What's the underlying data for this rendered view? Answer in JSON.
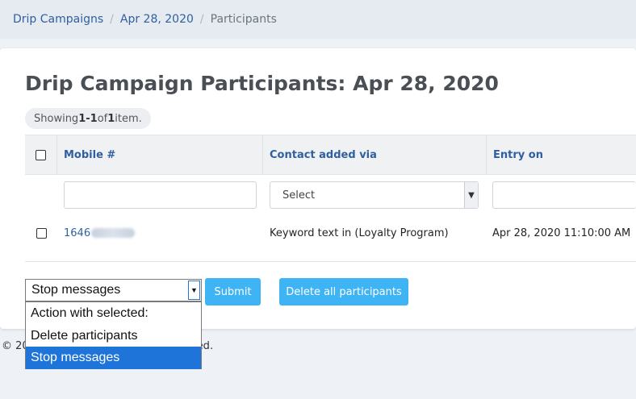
{
  "breadcrumb": {
    "items": [
      {
        "label": "Drip Campaigns"
      },
      {
        "label": "Apr 28, 2020"
      },
      {
        "label": "Participants"
      }
    ],
    "separator": "/"
  },
  "page": {
    "title": "Drip Campaign Participants: Apr 28, 2020"
  },
  "summary": {
    "prefix": "Showing ",
    "range": "1-1",
    "of": " of ",
    "total": "1",
    "suffix": " item."
  },
  "table": {
    "columns": [
      {
        "label": "Mobile #"
      },
      {
        "label": "Contact added via"
      },
      {
        "label": "Entry on"
      }
    ],
    "filters": {
      "mobile_value": "",
      "contact_select_value": "Select",
      "entry_value": ""
    },
    "rows": [
      {
        "mobile_visible": "1646",
        "contact_added_via": "Keyword text in (Loyalty Program)",
        "entry_on": "Apr 28, 2020 11:10:00 AM"
      }
    ]
  },
  "actions": {
    "selected_action": "Stop messages",
    "submit_label": "Submit",
    "delete_all_label": "Delete all participants",
    "options": [
      {
        "label": "Action with selected:"
      },
      {
        "label": "Delete participants"
      },
      {
        "label": "Stop messages",
        "selected": true
      }
    ]
  },
  "footer": {
    "left_text": "© 20",
    "right_text": "ed."
  },
  "colors": {
    "link": "#2f5fa0",
    "button": "#3fb4f5",
    "selected_option": "#1e74d9"
  },
  "icons": {
    "select_arrow": "chevron-down-icon"
  }
}
